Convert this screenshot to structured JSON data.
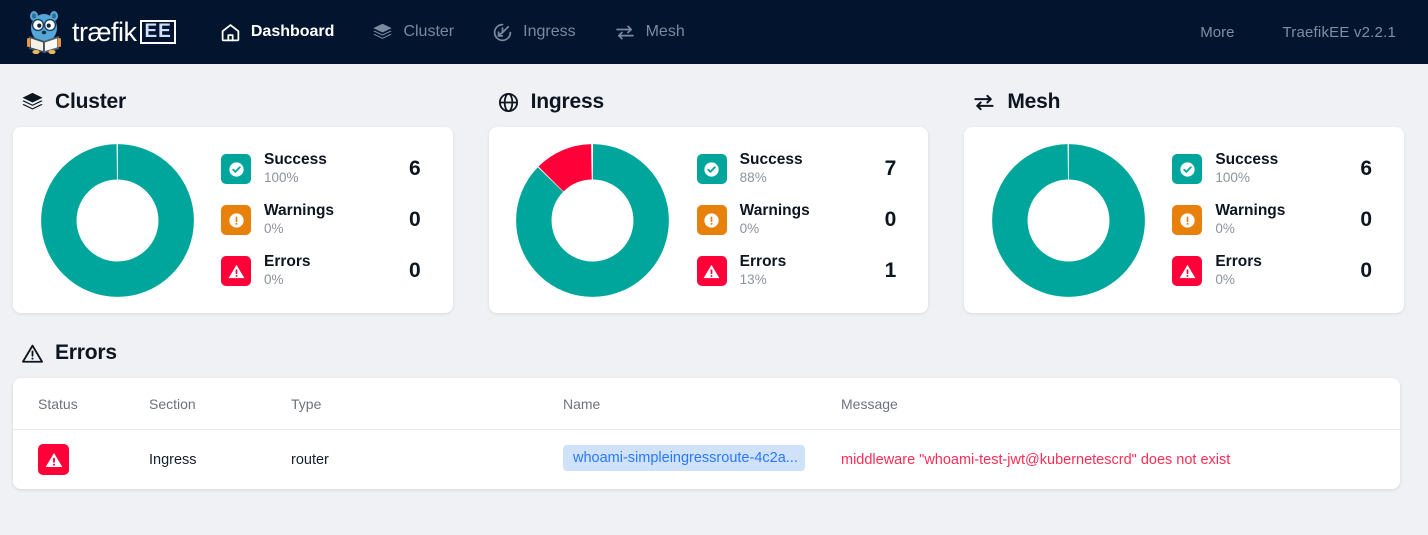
{
  "navbar": {
    "brand_name": "træfik",
    "brand_badge": "EE",
    "items": [
      {
        "label": "Dashboard",
        "icon": "home-icon",
        "active": true
      },
      {
        "label": "Cluster",
        "icon": "layers-icon",
        "active": false
      },
      {
        "label": "Ingress",
        "icon": "ingress-gauge-icon",
        "active": false
      },
      {
        "label": "Mesh",
        "icon": "exchange-arrows-icon",
        "active": false
      }
    ],
    "more_label": "More",
    "version_label": "TraefikEE  v2.2.1"
  },
  "colors": {
    "navbar_bg": "#02142e",
    "page_bg": "#f0f1f4",
    "success": "#00a69c",
    "warning": "#e8810c",
    "error": "#ff0039",
    "link": "#2979ff",
    "chip_bg": "#cfe2f9",
    "message": "#ff2d55"
  },
  "sections": [
    {
      "title": "Cluster",
      "icon": "layers-icon",
      "stats": [
        {
          "label": "Success",
          "percent": "100%",
          "value": "6",
          "icon": "check-circle-icon",
          "color": "#00a69c"
        },
        {
          "label": "Warnings",
          "percent": "0%",
          "value": "0",
          "icon": "exclamation-circle-icon",
          "color": "#e8810c"
        },
        {
          "label": "Errors",
          "percent": "0%",
          "value": "0",
          "icon": "warning-triangle-icon",
          "color": "#ff0039"
        }
      ],
      "chart_data": {
        "type": "pie",
        "title": "Cluster",
        "categories": [
          "Success",
          "Warnings",
          "Errors"
        ],
        "values": [
          6,
          0,
          0
        ],
        "percents": [
          100,
          0,
          0
        ],
        "colors": [
          "#00a69c",
          "#e8810c",
          "#ff0039"
        ],
        "donut": true,
        "legend": "right"
      }
    },
    {
      "title": "Ingress",
      "icon": "globe-icon",
      "stats": [
        {
          "label": "Success",
          "percent": "88%",
          "value": "7",
          "icon": "check-circle-icon",
          "color": "#00a69c"
        },
        {
          "label": "Warnings",
          "percent": "0%",
          "value": "0",
          "icon": "exclamation-circle-icon",
          "color": "#e8810c"
        },
        {
          "label": "Errors",
          "percent": "13%",
          "value": "1",
          "icon": "warning-triangle-icon",
          "color": "#ff0039"
        }
      ],
      "chart_data": {
        "type": "pie",
        "title": "Ingress",
        "categories": [
          "Success",
          "Warnings",
          "Errors"
        ],
        "values": [
          7,
          0,
          1
        ],
        "percents": [
          88,
          0,
          13
        ],
        "colors": [
          "#00a69c",
          "#e8810c",
          "#ff0039"
        ],
        "donut": true,
        "legend": "right"
      }
    },
    {
      "title": "Mesh",
      "icon": "exchange-arrows-icon",
      "stats": [
        {
          "label": "Success",
          "percent": "100%",
          "value": "6",
          "icon": "check-circle-icon",
          "color": "#00a69c"
        },
        {
          "label": "Warnings",
          "percent": "0%",
          "value": "0",
          "icon": "exclamation-circle-icon",
          "color": "#e8810c"
        },
        {
          "label": "Errors",
          "percent": "0%",
          "value": "0",
          "icon": "warning-triangle-icon",
          "color": "#ff0039"
        }
      ],
      "chart_data": {
        "type": "pie",
        "title": "Mesh",
        "categories": [
          "Success",
          "Warnings",
          "Errors"
        ],
        "values": [
          6,
          0,
          0
        ],
        "percents": [
          100,
          0,
          0
        ],
        "colors": [
          "#00a69c",
          "#e8810c",
          "#ff0039"
        ],
        "donut": true,
        "legend": "right"
      }
    }
  ],
  "errors": {
    "title": "Errors",
    "icon": "warning-triangle-outline-icon",
    "columns": [
      "Status",
      "Section",
      "Type",
      "Name",
      "Message"
    ],
    "rows": [
      {
        "status_icon": "warning-triangle-icon",
        "section": "Ingress",
        "type": "router",
        "name": "whoami-simpleingressroute-4c2a...",
        "message": "middleware \"whoami-test-jwt@kubernetescrd\" does not exist"
      }
    ]
  }
}
